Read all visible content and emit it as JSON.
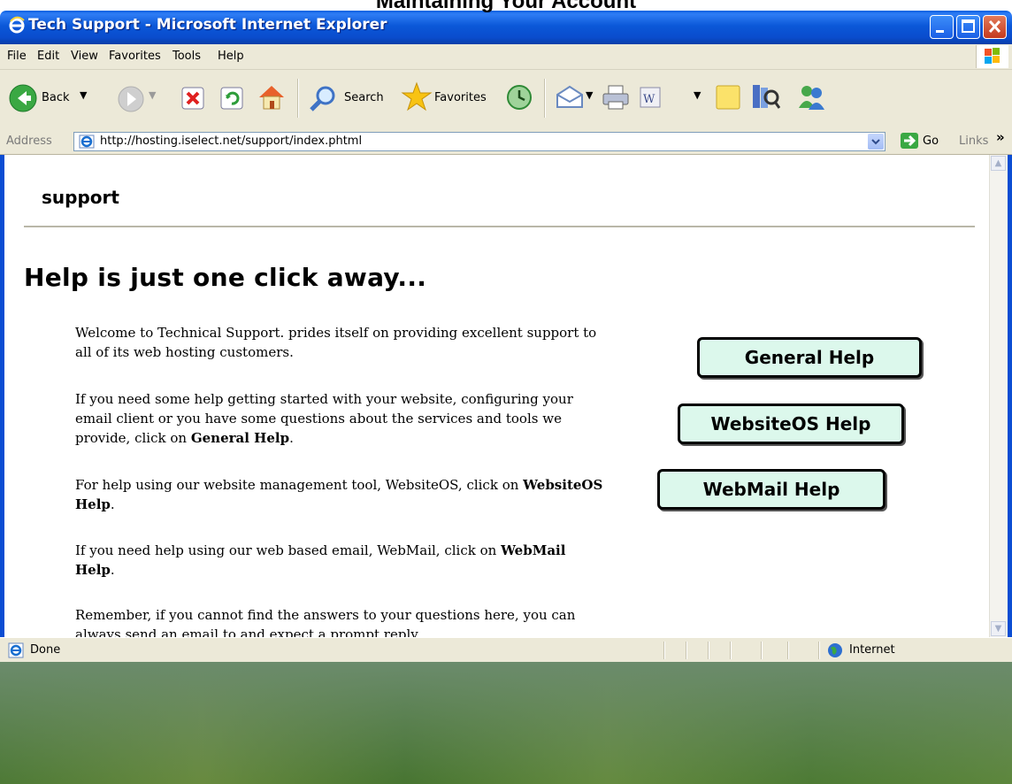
{
  "slide_title": "Maintaining Your Account",
  "window": {
    "title": "Tech Support - Microsoft Internet Explorer"
  },
  "menu": [
    "File",
    "Edit",
    "View",
    "Favorites",
    "Tools",
    "Help"
  ],
  "toolbar": {
    "back_label": "Back",
    "search_label": "Search",
    "favorites_label": "Favorites"
  },
  "address": {
    "label": "Address",
    "url": "http://hosting.iselect.net/support/index.phtml",
    "go_label": "Go",
    "links_label": "Links"
  },
  "page": {
    "section_label": "support",
    "heading": "Help is just one click away...",
    "paragraphs": [
      {
        "text": "Welcome to Technical Support. prides itself on providing excellent support to all of its web hosting customers."
      },
      {
        "text": "If you need some help getting started with your website, configuring your email client or you have some questions about the services and tools we provide, click on ",
        "bold": "General Help",
        "after": "."
      },
      {
        "text": "For help using our website management tool, WebsiteOS, click on ",
        "bold": "WebsiteOS Help",
        "after": "."
      },
      {
        "text": "If you need help using our web based email, WebMail, click on ",
        "bold": "WebMail Help",
        "after": "."
      },
      {
        "text": "Remember, if you cannot find the answers to your questions here, you can always send an email to and expect a prompt reply."
      }
    ],
    "buttons": [
      "General Help",
      "WebsiteOS Help",
      "WebMail Help"
    ]
  },
  "status": {
    "text": "Done",
    "zone": "Internet"
  },
  "colors": {
    "titlebar": "#0a4ccd",
    "button_fill": "#dcf8ec",
    "chrome": "#ece9d8"
  },
  "icons": [
    "ie-icon",
    "back-arrow-icon",
    "forward-arrow-icon",
    "stop-icon",
    "refresh-icon",
    "home-icon",
    "search-icon",
    "favorites-star-icon",
    "history-icon",
    "mail-icon",
    "print-icon",
    "word-icon",
    "note-icon",
    "research-icon",
    "messenger-icon",
    "go-arrow-icon",
    "globe-icon"
  ]
}
